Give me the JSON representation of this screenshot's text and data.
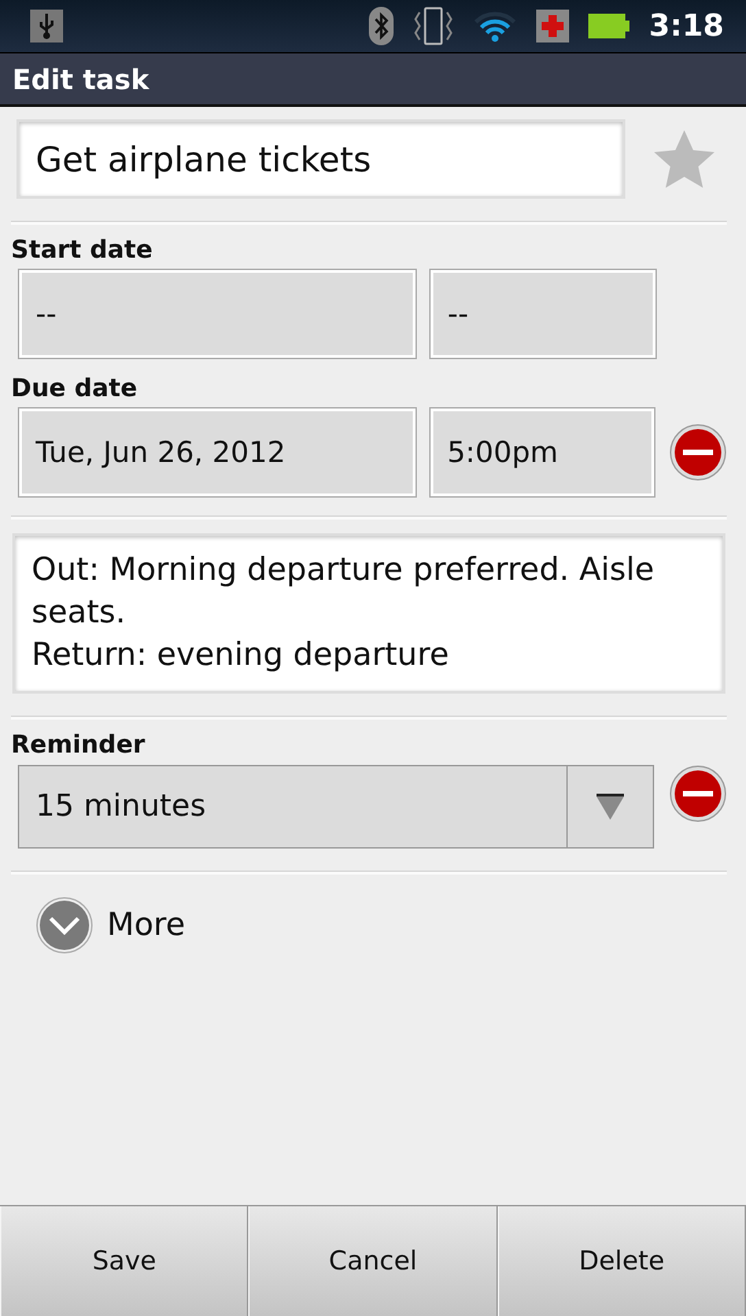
{
  "status_bar": {
    "time": "3:18"
  },
  "title_bar": {
    "title": "Edit task"
  },
  "task": {
    "title": "Get airplane tickets",
    "starred": false
  },
  "dates": [
    {
      "label": "Start date",
      "date": "--",
      "time": "--",
      "clear_button": false
    },
    {
      "label": "Due date",
      "date": "Tue, Jun 26, 2012",
      "time": "5:00pm",
      "clear_button": true
    }
  ],
  "notes": "Out: Morning departure preferred. Aisle seats.\nReturn: evening departure",
  "reminder": {
    "label": "Reminder",
    "value": "15 minutes",
    "clear_button": true
  },
  "more": {
    "label": "More",
    "expanded": false
  },
  "buttons": [
    "Save",
    "Cancel",
    "Delete"
  ]
}
